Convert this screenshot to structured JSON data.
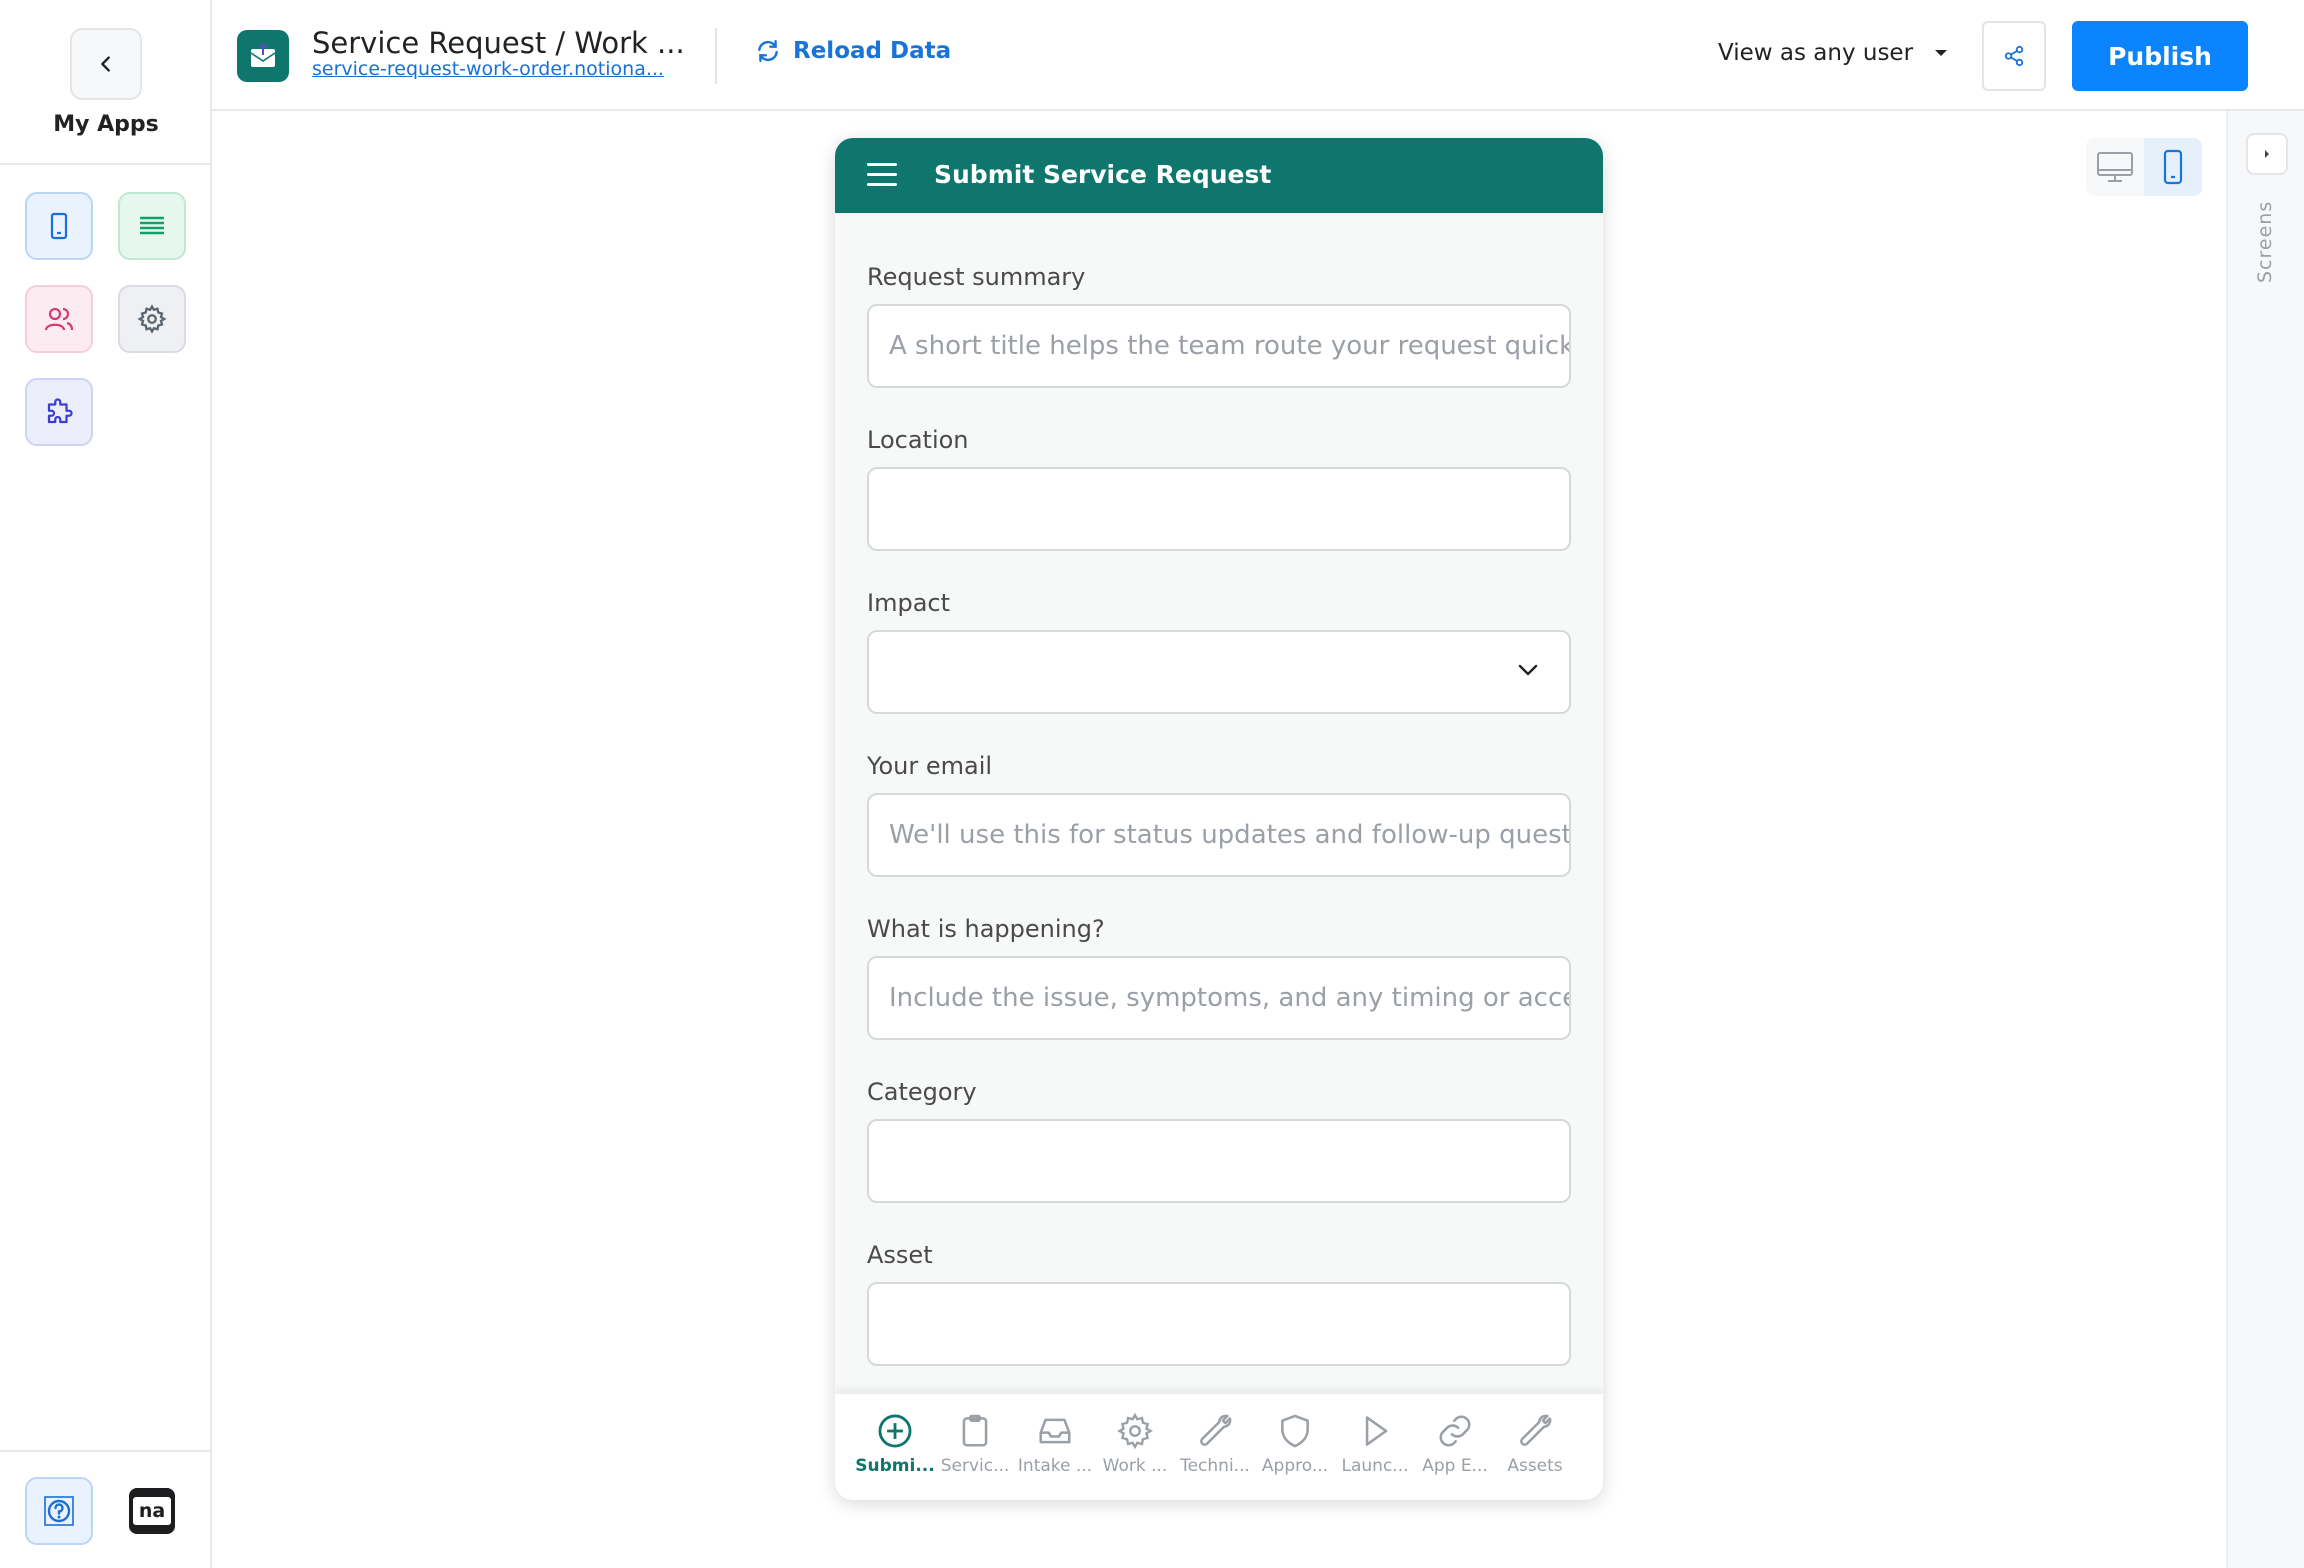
{
  "sidebar": {
    "back_label": "My Apps",
    "tools": [
      {
        "name": "mobile-screens",
        "icon": "phone-icon",
        "color": "#1a6fd6",
        "bg": "#eaf3fd"
      },
      {
        "name": "data",
        "icon": "list-icon",
        "color": "#12a06a",
        "bg": "#e6f7ef"
      },
      {
        "name": "users",
        "icon": "users-icon",
        "color": "#d63a73",
        "bg": "#fdebf2"
      },
      {
        "name": "settings",
        "icon": "gear-icon",
        "color": "#5b6470",
        "bg": "#eef0f3"
      },
      {
        "name": "plugins",
        "icon": "puzzle-icon",
        "color": "#3b3fd0",
        "bg": "#eceefb"
      }
    ],
    "help_icon": "help-icon",
    "brand_mark": "na"
  },
  "topbar": {
    "app_title": "Service Request / Work ...",
    "app_url": "service-request-work-order.notiona...",
    "reload_label": "Reload Data",
    "view_as_label": "View as any user",
    "publish_label": "Publish"
  },
  "right_panel": {
    "label": "Screens"
  },
  "phone": {
    "header_title": "Submit Service Request",
    "fields": [
      {
        "label": "Request summary",
        "placeholder": "A short title helps the team route your request quick",
        "type": "text"
      },
      {
        "label": "Location",
        "placeholder": "",
        "type": "text"
      },
      {
        "label": "Impact",
        "placeholder": "",
        "type": "select"
      },
      {
        "label": "Your email",
        "placeholder": "We'll use this for status updates and follow-up quest",
        "type": "text"
      },
      {
        "label": "What is happening?",
        "placeholder": "Include the issue, symptoms, and any timing or acce",
        "type": "text"
      },
      {
        "label": "Category",
        "placeholder": "",
        "type": "text"
      },
      {
        "label": "Asset",
        "placeholder": "",
        "type": "text"
      }
    ],
    "nav": [
      {
        "label": "Submi...",
        "icon": "plus-circle-icon",
        "active": true
      },
      {
        "label": "Servic...",
        "icon": "clipboard-icon",
        "active": false
      },
      {
        "label": "Intake ...",
        "icon": "inbox-icon",
        "active": false
      },
      {
        "label": "Work ...",
        "icon": "gear-icon",
        "active": false
      },
      {
        "label": "Techni...",
        "icon": "wrench-icon",
        "active": false
      },
      {
        "label": "Appro...",
        "icon": "shield-icon",
        "active": false
      },
      {
        "label": "Launc...",
        "icon": "play-icon",
        "active": false
      },
      {
        "label": "App E...",
        "icon": "link-icon",
        "active": false
      },
      {
        "label": "Assets",
        "icon": "wrench-icon",
        "active": false
      }
    ]
  },
  "colors": {
    "brand": "#0f766e",
    "primary": "#0a84ff",
    "link": "#1a73d9"
  }
}
